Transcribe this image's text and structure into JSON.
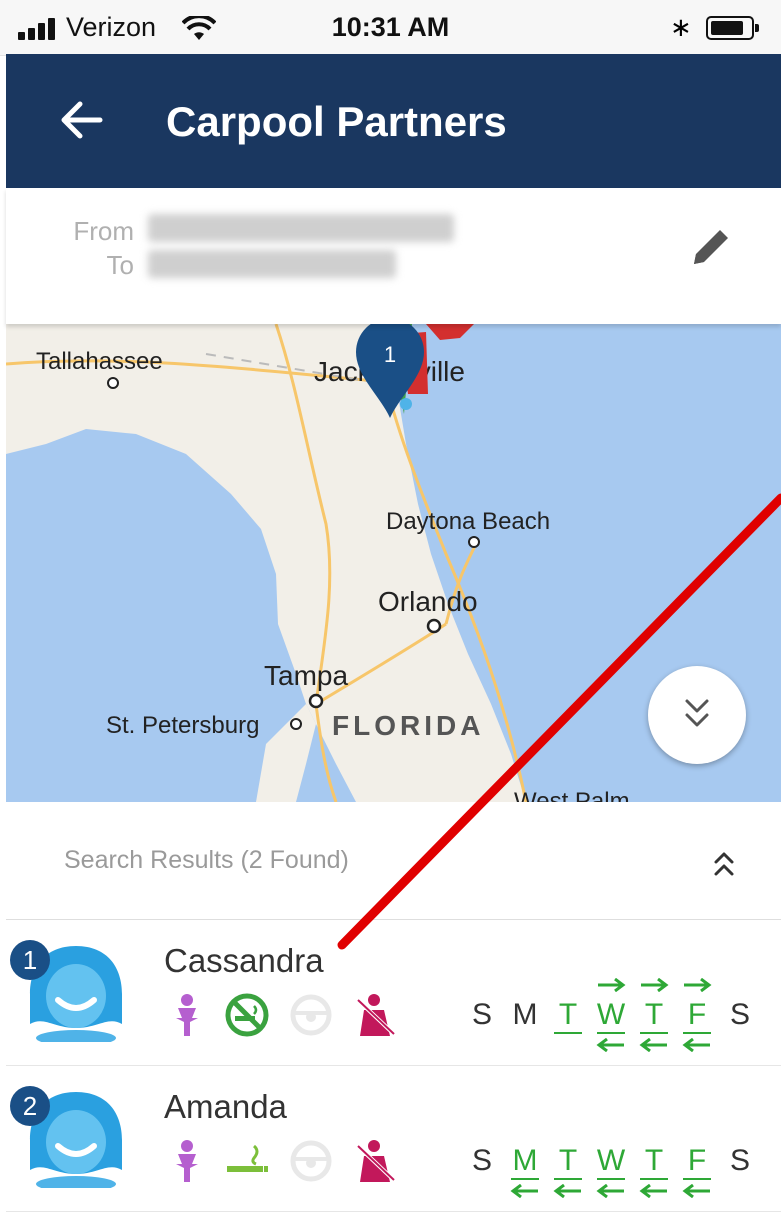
{
  "status_bar": {
    "carrier": "Verizon",
    "time": "10:31 AM",
    "icons": [
      "signal-icon",
      "wifi-icon",
      "bluetooth-icon",
      "battery-icon"
    ]
  },
  "app_bar": {
    "title": "Carpool Partners",
    "back_icon": "arrow-left-icon"
  },
  "route": {
    "from_label": "From",
    "to_label": "To",
    "edit_icon": "pencil-icon"
  },
  "map": {
    "cities": [
      "Tallahassee",
      "Jacksonville",
      "Daytona Beach",
      "Orlando",
      "Tampa",
      "St. Petersburg",
      "West Palm"
    ],
    "state": "FLORIDA",
    "marker_label": "1",
    "expand_icon": "chevron-double-down-icon"
  },
  "results": {
    "title": "Search Results (2 Found)",
    "collapse_icon": "chevron-double-up-icon"
  },
  "days": [
    "S",
    "M",
    "T",
    "W",
    "T",
    "F",
    "S"
  ],
  "partners": [
    {
      "rank": "1",
      "name": "Cassandra",
      "preferences": [
        "female-icon",
        "no-smoking-icon",
        "steering-wheel-icon",
        "no-rider-seat-icon"
      ],
      "active_days": [
        2,
        3,
        4,
        5
      ],
      "to_days": [
        3,
        4,
        5
      ],
      "from_days": [
        3,
        4,
        5
      ]
    },
    {
      "rank": "2",
      "name": "Amanda",
      "preferences": [
        "female-icon",
        "smoking-icon",
        "steering-wheel-icon",
        "no-rider-seat-icon"
      ],
      "active_days": [
        1,
        2,
        3,
        4,
        5
      ],
      "to_days": [],
      "from_days": [
        1,
        2,
        3,
        4,
        5
      ]
    }
  ],
  "colors": {
    "app_bar": "#1a3760",
    "active_day": "#2ea836",
    "female": "#b55fcf",
    "seat": "#c2185b",
    "annotation": "#e00000"
  }
}
